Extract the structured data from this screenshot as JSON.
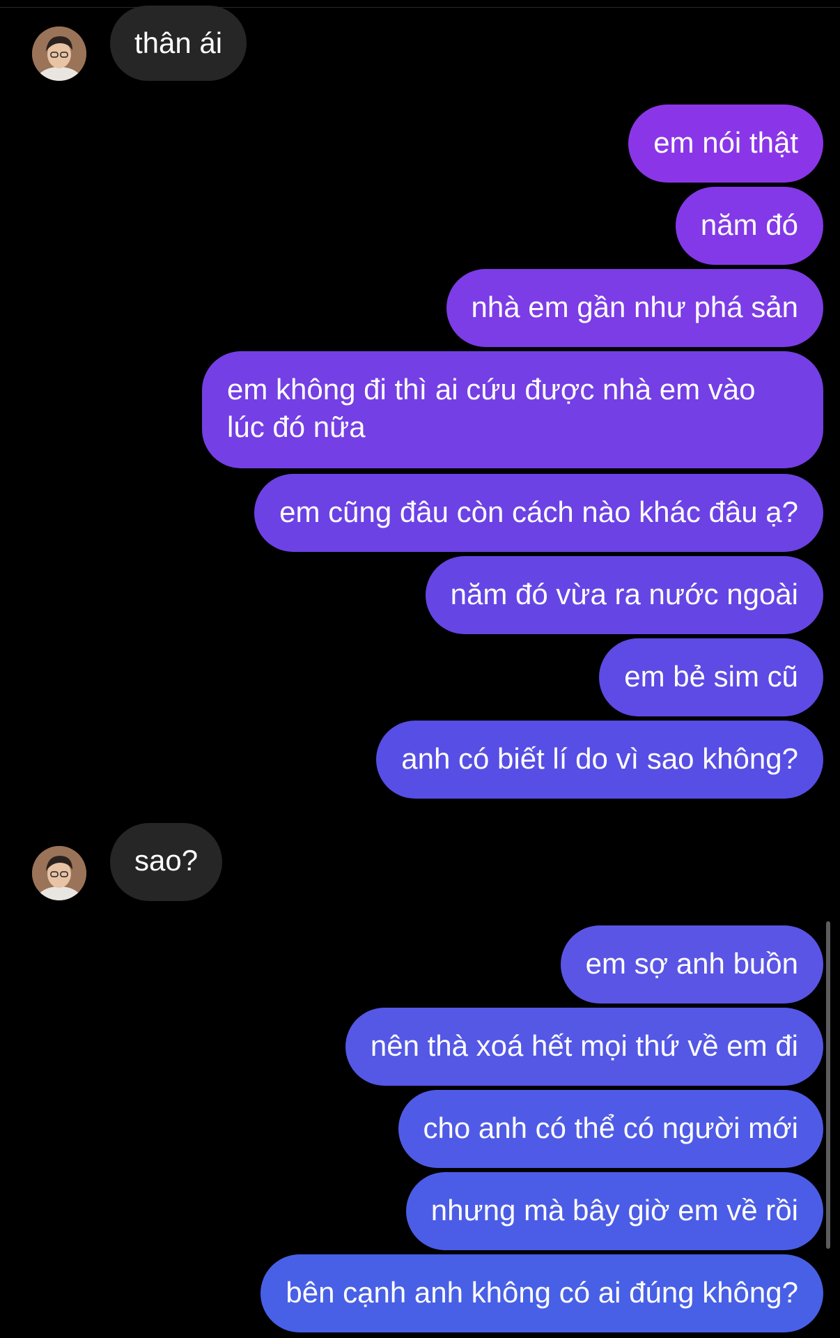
{
  "conversation": {
    "incoming": [
      {
        "text": "thân ái"
      },
      {
        "text": "sao?"
      }
    ],
    "outgoing_group_1": [
      {
        "text": "em nói thật"
      },
      {
        "text": "năm đó"
      },
      {
        "text": "nhà em gần như phá sản"
      },
      {
        "text": "em không đi thì ai cứu được nhà em vào lúc đó nữa"
      },
      {
        "text": "em cũng đâu còn cách nào khác đâu ạ?"
      },
      {
        "text": "năm đó vừa ra nước ngoài"
      },
      {
        "text": "em bẻ sim cũ"
      },
      {
        "text": "anh có biết lí do vì sao không?"
      }
    ],
    "outgoing_group_2": [
      {
        "text": "em sợ anh buồn"
      },
      {
        "text": "nên thà xoá hết mọi thứ về em đi"
      },
      {
        "text": "cho anh có thể có người mới"
      },
      {
        "text": "nhưng mà bây giờ em về rồi"
      },
      {
        "text": "bên cạnh anh không có ai đúng không?"
      }
    ]
  },
  "colors": {
    "background": "#000000",
    "incoming_bubble": "#262626",
    "outgoing_gradient_top": "#8a36e8",
    "outgoing_gradient_bottom": "#4a5fe6"
  }
}
